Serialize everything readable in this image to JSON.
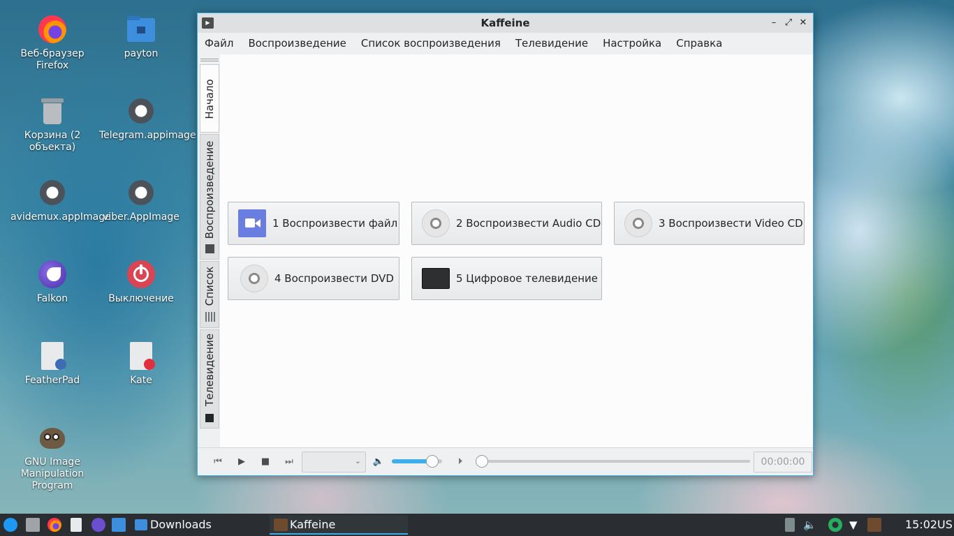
{
  "desktop": {
    "icons": [
      {
        "label": "Веб-браузер Firefox"
      },
      {
        "label": "payton"
      },
      {
        "label": "Корзина (2 объекта)"
      },
      {
        "label": "Telegram.appimage"
      },
      {
        "label": "avidemux.appImage"
      },
      {
        "label": "viber.AppImage"
      },
      {
        "label": "Falkon"
      },
      {
        "label": "Выключение"
      },
      {
        "label": "FeatherPad"
      },
      {
        "label": "Kate"
      },
      {
        "label": "GNU Image Manipulation Program"
      }
    ]
  },
  "window": {
    "title": "Kaffeine",
    "menu": [
      "Файл",
      "Воспроизведение",
      "Список воспроизведения",
      "Телевидение",
      "Настройка",
      "Справка"
    ],
    "side_tabs": [
      "Начало",
      "Воспроизведение",
      "Список",
      "Телевидение"
    ],
    "buttons": [
      {
        "label": "1 Воспроизвести файл",
        "icon": "video-camera-icon"
      },
      {
        "label": "2 Воспроизвести Audio CD",
        "icon": "cd-icon"
      },
      {
        "label": "3 Воспроизвести Video CD",
        "icon": "cd-icon"
      },
      {
        "label": "4 Воспроизвести DVD",
        "icon": "dvd-icon"
      },
      {
        "label": "5 Цифровое телевидение",
        "icon": "tv-icon"
      }
    ],
    "controls": {
      "volume_fraction": 0.8,
      "seek_fraction": 0.0,
      "time": "00:00:00"
    },
    "accent": "#3daee9"
  },
  "taskbar": {
    "downloads_label": "Downloads",
    "kaffeine_label": "Kaffeine",
    "clock": "15:02",
    "layout": "US"
  }
}
